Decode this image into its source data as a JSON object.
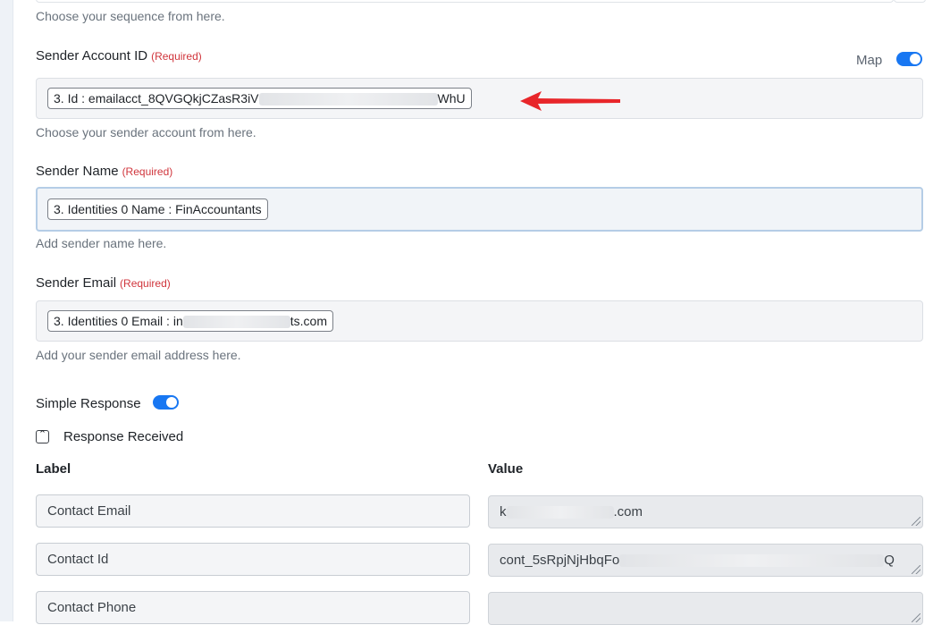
{
  "sequence": {
    "hint": "Choose your sequence from here."
  },
  "sender_account": {
    "label": "Sender Account ID",
    "required": "(Required)",
    "map_label": "Map",
    "value_prefix": "3. Id : emailacct_8QVGQkjCZasR3iV",
    "value_suffix": "WhU",
    "hint": "Choose your sender account from here."
  },
  "sender_name": {
    "label": "Sender Name",
    "required": "(Required)",
    "value": "3. Identities 0 Name : FinAccountants",
    "hint": "Add sender name here."
  },
  "sender_email": {
    "label": "Sender Email",
    "required": "(Required)",
    "value_prefix": "3. Identities 0 Email : in",
    "value_suffix": "ts.com",
    "hint": "Add your sender email address here."
  },
  "simple_response": {
    "label": "Simple Response",
    "enabled": true
  },
  "response_received": {
    "label": "Response Received",
    "toggle_icon": "chevron-up-icon",
    "columns": {
      "label": "Label",
      "value": "Value"
    },
    "rows": [
      {
        "label": "Contact Email",
        "value_prefix": "k",
        "value_suffix": ".com"
      },
      {
        "label": "Contact Id",
        "value_prefix": "cont_5sRpjNjHbqFo",
        "value_suffix": "Q"
      },
      {
        "label": "Contact Phone",
        "value_prefix": "",
        "value_suffix": ""
      }
    ]
  },
  "colors": {
    "accent": "#1877f2",
    "required": "#d0353c",
    "arrow": "#e8262a"
  }
}
